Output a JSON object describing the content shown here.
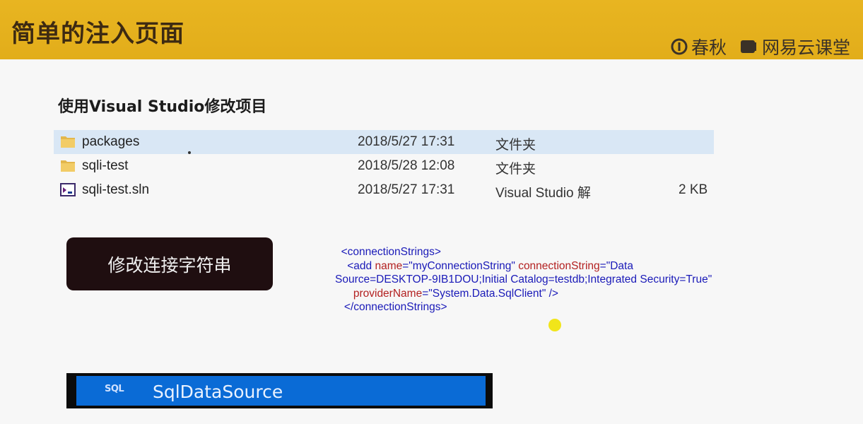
{
  "header": {
    "title": "简单的注入页面",
    "brand_chunqiu": "春秋",
    "brand_netease": "网易云课堂",
    "background_color": "#e6b31f"
  },
  "section": {
    "heading": "使用Visual Studio修改项目"
  },
  "files": [
    {
      "name": "packages",
      "date": "2018/5/27 17:31",
      "type": "文件夹",
      "size": "",
      "icon": "folder-icon",
      "selected": true
    },
    {
      "name": "sqli-test",
      "date": "2018/5/28 12:08",
      "type": "文件夹",
      "size": "",
      "icon": "folder-icon",
      "selected": false
    },
    {
      "name": "sqli-test.sln",
      "date": "2018/5/27 17:31",
      "type": "Visual Studio 解",
      "size": "2 KB",
      "icon": "vs-solution-icon",
      "selected": false
    }
  ],
  "action_button": {
    "label": "修改连接字符串"
  },
  "code": {
    "line1": "<connectionStrings>",
    "line2_tag": "<add ",
    "line2_attr1": "name",
    "line2_val1": "=\"myConnectionString\" ",
    "line2_attr2": "connectionString",
    "line2_val2": "=\"Data",
    "line3": "Source=DESKTOP-9IB1DOU;Initial Catalog=testdb;Integrated Security=True\"",
    "line4_attr": "providerName",
    "line4_val": "=\"System.Data.SqlClient\" />",
    "line5": "</connectionStrings>"
  },
  "sqldatasource": {
    "icon_text": "SQL",
    "label": "SqlDataSource"
  }
}
